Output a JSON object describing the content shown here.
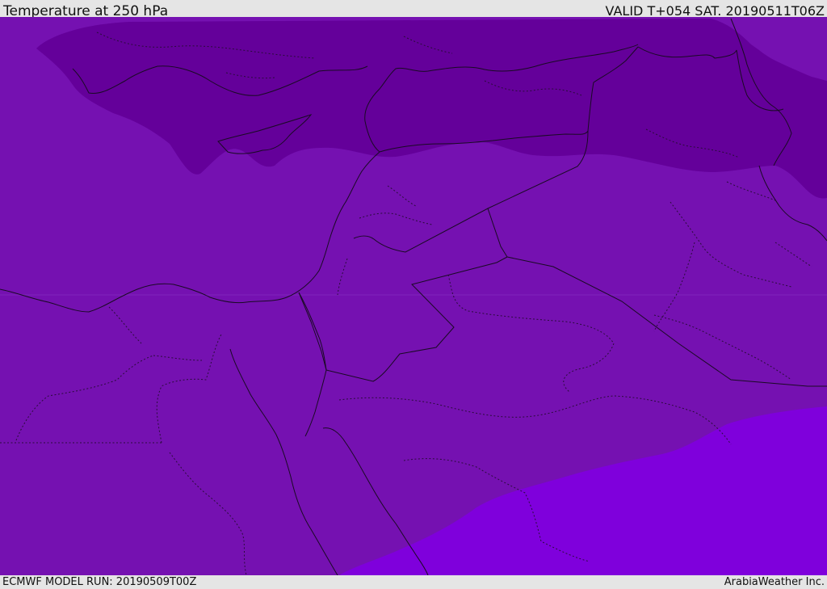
{
  "header": {
    "title": "Temperature at 250 hPa",
    "valid": "VALID T+054 SAT. 20190511T06Z"
  },
  "footer": {
    "model_run": "ECMWF MODEL RUN: 20190509T00Z",
    "provider": "ArabiaWeather Inc."
  },
  "map": {
    "layer": "temperature-250hPa",
    "colors": {
      "cold_band": "#64009a",
      "mid_band": "#7511b1",
      "warm_band": "#7f00dc",
      "sea_mid": "#7712b6"
    }
  }
}
